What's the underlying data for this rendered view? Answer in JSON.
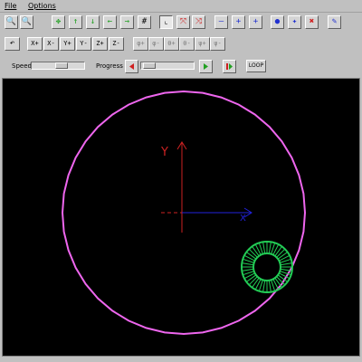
{
  "menubar": {
    "file": "File",
    "options": "Options"
  },
  "speed_label": "Speed",
  "progress_label": "Progress",
  "loop_label": "LOOP",
  "speed_value": 0.6,
  "progress_value": 0.05,
  "toolbar1": [
    {
      "name": "zoom-in-button",
      "icon": "magnifier-plus-icon",
      "glyph": "🔍"
    },
    {
      "name": "zoom-out-button",
      "icon": "magnifier-minus-icon",
      "glyph": "🔍"
    },
    {
      "name": "pan-all-button",
      "icon": "move-icon",
      "glyph": "✥"
    },
    {
      "name": "pan-up-button",
      "icon": "arrow-up-icon",
      "glyph": "↑"
    },
    {
      "name": "pan-down-button",
      "icon": "arrow-down-icon",
      "glyph": "↓"
    },
    {
      "name": "pan-left-button",
      "icon": "arrow-left-icon",
      "glyph": "←"
    },
    {
      "name": "pan-right-button",
      "icon": "arrow-right-icon",
      "glyph": "→"
    },
    {
      "name": "grid-button",
      "icon": "grid-icon",
      "glyph": "#"
    },
    {
      "name": "axes-button",
      "icon": "axes-icon",
      "glyph": "⌞"
    },
    {
      "name": "fit-button",
      "icon": "fit-icon",
      "glyph": "⤧"
    },
    {
      "name": "rotate-button",
      "icon": "rotate-icon",
      "glyph": "⤨"
    },
    {
      "name": "view-x-button",
      "icon": "line-icon",
      "glyph": "—"
    },
    {
      "name": "view-y-button",
      "icon": "cross-icon",
      "glyph": "+"
    },
    {
      "name": "view-z-button",
      "icon": "cross-icon",
      "glyph": "+"
    },
    {
      "name": "point-button",
      "icon": "dot-icon",
      "glyph": "●"
    },
    {
      "name": "points-button",
      "icon": "star-icon",
      "glyph": "✦"
    },
    {
      "name": "cross-button",
      "icon": "x-icon",
      "glyph": "✖"
    },
    {
      "name": "draw-button",
      "icon": "pen-icon",
      "glyph": "✎"
    }
  ],
  "toolbar2": [
    {
      "name": "undo-button",
      "icon": "undo-icon",
      "glyph": "↶"
    },
    {
      "name": "x-plus-button",
      "label": "X+"
    },
    {
      "name": "x-minus-button",
      "label": "X-"
    },
    {
      "name": "y-plus-button",
      "label": "Y+"
    },
    {
      "name": "y-minus-button",
      "label": "Y-"
    },
    {
      "name": "z-plus-button",
      "label": "Z+"
    },
    {
      "name": "z-minus-button",
      "label": "Z-"
    },
    {
      "name": "phi-plus-button",
      "label": "φ+"
    },
    {
      "name": "phi-minus-button",
      "label": "φ-"
    },
    {
      "name": "theta-plus-button",
      "label": "θ+"
    },
    {
      "name": "theta-minus-button",
      "label": "θ-"
    },
    {
      "name": "psi-plus-button",
      "label": "ψ+"
    },
    {
      "name": "psi-minus-button",
      "label": "ψ-"
    }
  ],
  "scene": {
    "y_axis_label": "Y",
    "x_axis_label": "X",
    "circle_color": "#ee66ee",
    "disk_color": "#22cc55",
    "y_axis_color": "#cc2222",
    "x_axis_color": "#2222dd"
  }
}
